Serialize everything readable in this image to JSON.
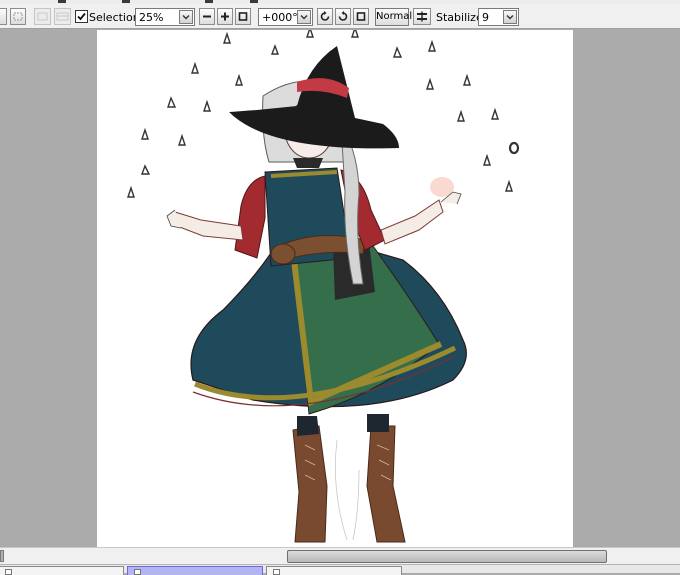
{
  "toolbar": {
    "selection_label": "Selection",
    "selection_checked": true,
    "zoom_value": "25%",
    "rotation_value": "+000°",
    "blend_mode_label": "Normal",
    "stabilizer_label": "Stabilizer",
    "stabilizer_value": "9"
  },
  "icons": {
    "selection_check": "checkmark-icon",
    "zoom_out": "zoom-out-icon",
    "zoom_in": "zoom-in-icon",
    "zoom_reset": "zoom-reset-icon",
    "rotate_left": "rotate-left-icon",
    "rotate_right": "rotate-right-icon",
    "rotate_reset": "rotate-reset-icon",
    "flip": "flip-horizontal-icon",
    "dropdown": "chevron-down-icon"
  },
  "colors": {
    "toolbar_bg": "#f0f0f0",
    "workspace_bg": "#ababab",
    "canvas_bg": "#ffffff",
    "active_tab": "#b4b4f4"
  }
}
